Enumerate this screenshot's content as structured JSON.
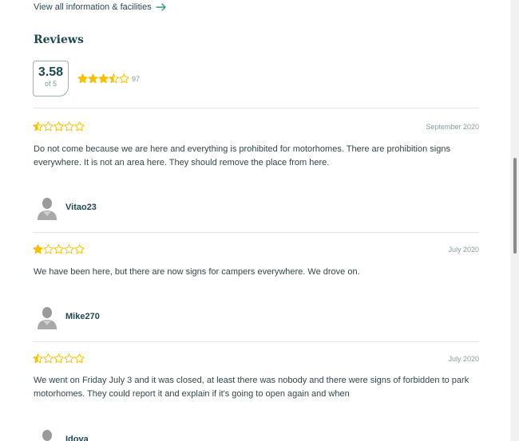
{
  "header": {
    "view_all_label": "View all information & facilities"
  },
  "reviews": {
    "title": "Reviews",
    "score": "3.58",
    "score_of": "of 5",
    "rating_stars": 3.5,
    "count": "97",
    "items": [
      {
        "rating": 0.5,
        "date": "September 2020",
        "text": "Do not come because we are here and everything is prohibited for motorhomes. There are prohibition signs everywhere. It is not an area here. They should remove the place from here.",
        "user": "Vitao23"
      },
      {
        "rating": 1,
        "date": "July 2020",
        "text": "We have been here, but there are now signs for campers everywhere. We drove on.",
        "user": "Mike270"
      },
      {
        "rating": 0.5,
        "date": "July 2020",
        "text": "We went on Friday July 3 and it was closed, at least there was nobody and there were signs of forbidden to park motorhomes. They could report it and explain if it's going to open again and when",
        "user": "Idova"
      }
    ]
  },
  "colors": {
    "star": "#f5c000",
    "accent": "#2aa37a",
    "heading": "#1d4a50"
  },
  "icons": {
    "view_all": "arrow-right-icon",
    "star": "star-icon",
    "avatar": "user-silhouette-icon"
  }
}
